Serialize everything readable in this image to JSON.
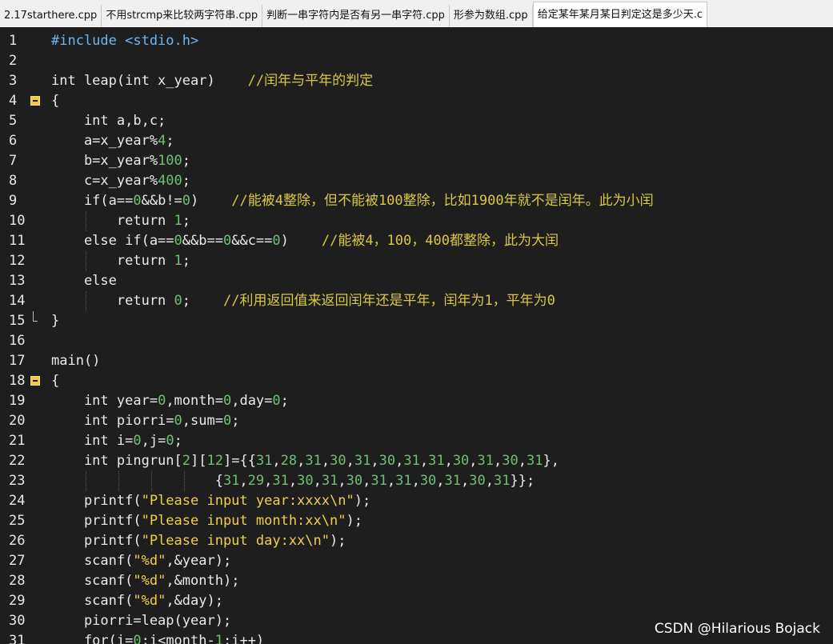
{
  "tabs": [
    {
      "label": "2.17starthere.cpp",
      "active": false
    },
    {
      "label": "不用strcmp来比较两字符串.cpp",
      "active": false
    },
    {
      "label": "判断一串字符内是否有另一串字符.cpp",
      "active": false
    },
    {
      "label": "形参为数组.cpp",
      "active": false
    },
    {
      "label": "给定某年某月某日判定这是多少天.c",
      "active": true
    }
  ],
  "lines": [
    {
      "n": "1",
      "tokens": [
        {
          "t": "#include <stdio.h>",
          "c": "inc"
        }
      ]
    },
    {
      "n": "2",
      "tokens": []
    },
    {
      "n": "3",
      "tokens": [
        {
          "t": "int leap(int x_year)    ",
          "c": "id"
        },
        {
          "t": "//闰年与平年的判定",
          "c": "cmt"
        }
      ]
    },
    {
      "n": "4",
      "fold": "open",
      "tokens": [
        {
          "t": "{",
          "c": "id"
        }
      ]
    },
    {
      "n": "5",
      "tokens": [
        {
          "t": "    int a,b,c;",
          "c": "id"
        }
      ]
    },
    {
      "n": "6",
      "tokens": [
        {
          "t": "    a=x_year%",
          "c": "id"
        },
        {
          "t": "4",
          "c": "num"
        },
        {
          "t": ";",
          "c": "id"
        }
      ]
    },
    {
      "n": "7",
      "tokens": [
        {
          "t": "    b=x_year%",
          "c": "id"
        },
        {
          "t": "100",
          "c": "num"
        },
        {
          "t": ";",
          "c": "id"
        }
      ]
    },
    {
      "n": "8",
      "tokens": [
        {
          "t": "    c=x_year%",
          "c": "id"
        },
        {
          "t": "400",
          "c": "num"
        },
        {
          "t": ";",
          "c": "id"
        }
      ]
    },
    {
      "n": "9",
      "tokens": [
        {
          "t": "    if(a==",
          "c": "id"
        },
        {
          "t": "0",
          "c": "num"
        },
        {
          "t": "&&b!=",
          "c": "id"
        },
        {
          "t": "0",
          "c": "num"
        },
        {
          "t": ")    ",
          "c": "id"
        },
        {
          "t": "//能被4整除，但不能被100整除，比如1900年就不是闰年。此为小闰",
          "c": "cmt"
        }
      ]
    },
    {
      "n": "10",
      "guides": [
        1
      ],
      "tokens": [
        {
          "t": "        return ",
          "c": "id"
        },
        {
          "t": "1",
          "c": "num"
        },
        {
          "t": ";",
          "c": "id"
        }
      ]
    },
    {
      "n": "11",
      "tokens": [
        {
          "t": "    else if(a==",
          "c": "id"
        },
        {
          "t": "0",
          "c": "num"
        },
        {
          "t": "&&b==",
          "c": "id"
        },
        {
          "t": "0",
          "c": "num"
        },
        {
          "t": "&&c==",
          "c": "id"
        },
        {
          "t": "0",
          "c": "num"
        },
        {
          "t": ")    ",
          "c": "id"
        },
        {
          "t": "//能被4，100，400都整除，此为大闰",
          "c": "cmt"
        }
      ]
    },
    {
      "n": "12",
      "guides": [
        1
      ],
      "tokens": [
        {
          "t": "        return ",
          "c": "id"
        },
        {
          "t": "1",
          "c": "num"
        },
        {
          "t": ";",
          "c": "id"
        }
      ]
    },
    {
      "n": "13",
      "tokens": [
        {
          "t": "    else",
          "c": "id"
        }
      ]
    },
    {
      "n": "14",
      "guides": [
        1
      ],
      "tokens": [
        {
          "t": "        return ",
          "c": "id"
        },
        {
          "t": "0",
          "c": "num"
        },
        {
          "t": ";    ",
          "c": "id"
        },
        {
          "t": "//利用返回值来返回闰年还是平年，闰年为1，平年为0",
          "c": "cmt"
        }
      ]
    },
    {
      "n": "15",
      "fold": "end",
      "tokens": [
        {
          "t": "}",
          "c": "id"
        }
      ]
    },
    {
      "n": "16",
      "tokens": []
    },
    {
      "n": "17",
      "tokens": [
        {
          "t": "main()",
          "c": "id"
        }
      ]
    },
    {
      "n": "18",
      "fold": "open",
      "tokens": [
        {
          "t": "{",
          "c": "id"
        }
      ]
    },
    {
      "n": "19",
      "tokens": [
        {
          "t": "    int year=",
          "c": "id"
        },
        {
          "t": "0",
          "c": "num"
        },
        {
          "t": ",month=",
          "c": "id"
        },
        {
          "t": "0",
          "c": "num"
        },
        {
          "t": ",day=",
          "c": "id"
        },
        {
          "t": "0",
          "c": "num"
        },
        {
          "t": ";",
          "c": "id"
        }
      ]
    },
    {
      "n": "20",
      "tokens": [
        {
          "t": "    int piorri=",
          "c": "id"
        },
        {
          "t": "0",
          "c": "num"
        },
        {
          "t": ",sum=",
          "c": "id"
        },
        {
          "t": "0",
          "c": "num"
        },
        {
          "t": ";",
          "c": "id"
        }
      ]
    },
    {
      "n": "21",
      "tokens": [
        {
          "t": "    int i=",
          "c": "id"
        },
        {
          "t": "0",
          "c": "num"
        },
        {
          "t": ",j=",
          "c": "id"
        },
        {
          "t": "0",
          "c": "num"
        },
        {
          "t": ";",
          "c": "id"
        }
      ]
    },
    {
      "n": "22",
      "tokens": [
        {
          "t": "    int pingrun[",
          "c": "id"
        },
        {
          "t": "2",
          "c": "num"
        },
        {
          "t": "][",
          "c": "id"
        },
        {
          "t": "12",
          "c": "num"
        },
        {
          "t": "]={{",
          "c": "id"
        },
        {
          "t": "31",
          "c": "num"
        },
        {
          "t": ",",
          "c": "id"
        },
        {
          "t": "28",
          "c": "num"
        },
        {
          "t": ",",
          "c": "id"
        },
        {
          "t": "31",
          "c": "num"
        },
        {
          "t": ",",
          "c": "id"
        },
        {
          "t": "30",
          "c": "num"
        },
        {
          "t": ",",
          "c": "id"
        },
        {
          "t": "31",
          "c": "num"
        },
        {
          "t": ",",
          "c": "id"
        },
        {
          "t": "30",
          "c": "num"
        },
        {
          "t": ",",
          "c": "id"
        },
        {
          "t": "31",
          "c": "num"
        },
        {
          "t": ",",
          "c": "id"
        },
        {
          "t": "31",
          "c": "num"
        },
        {
          "t": ",",
          "c": "id"
        },
        {
          "t": "30",
          "c": "num"
        },
        {
          "t": ",",
          "c": "id"
        },
        {
          "t": "31",
          "c": "num"
        },
        {
          "t": ",",
          "c": "id"
        },
        {
          "t": "30",
          "c": "num"
        },
        {
          "t": ",",
          "c": "id"
        },
        {
          "t": "31",
          "c": "num"
        },
        {
          "t": "},",
          "c": "id"
        }
      ]
    },
    {
      "n": "23",
      "guides": [
        1,
        2,
        3,
        4
      ],
      "tokens": [
        {
          "t": "                    {",
          "c": "id"
        },
        {
          "t": "31",
          "c": "num"
        },
        {
          "t": ",",
          "c": "id"
        },
        {
          "t": "29",
          "c": "num"
        },
        {
          "t": ",",
          "c": "id"
        },
        {
          "t": "31",
          "c": "num"
        },
        {
          "t": ",",
          "c": "id"
        },
        {
          "t": "30",
          "c": "num"
        },
        {
          "t": ",",
          "c": "id"
        },
        {
          "t": "31",
          "c": "num"
        },
        {
          "t": ",",
          "c": "id"
        },
        {
          "t": "30",
          "c": "num"
        },
        {
          "t": ",",
          "c": "id"
        },
        {
          "t": "31",
          "c": "num"
        },
        {
          "t": ",",
          "c": "id"
        },
        {
          "t": "31",
          "c": "num"
        },
        {
          "t": ",",
          "c": "id"
        },
        {
          "t": "30",
          "c": "num"
        },
        {
          "t": ",",
          "c": "id"
        },
        {
          "t": "31",
          "c": "num"
        },
        {
          "t": ",",
          "c": "id"
        },
        {
          "t": "30",
          "c": "num"
        },
        {
          "t": ",",
          "c": "id"
        },
        {
          "t": "31",
          "c": "num"
        },
        {
          "t": "}};",
          "c": "id"
        }
      ]
    },
    {
      "n": "24",
      "tokens": [
        {
          "t": "    printf(",
          "c": "id"
        },
        {
          "t": "\"Please input year:xxxx\\n\"",
          "c": "str"
        },
        {
          "t": ");",
          "c": "id"
        }
      ]
    },
    {
      "n": "25",
      "tokens": [
        {
          "t": "    printf(",
          "c": "id"
        },
        {
          "t": "\"Please input month:xx\\n\"",
          "c": "str"
        },
        {
          "t": ");",
          "c": "id"
        }
      ]
    },
    {
      "n": "26",
      "tokens": [
        {
          "t": "    printf(",
          "c": "id"
        },
        {
          "t": "\"Please input day:xx\\n\"",
          "c": "str"
        },
        {
          "t": ");",
          "c": "id"
        }
      ]
    },
    {
      "n": "27",
      "tokens": [
        {
          "t": "    scanf(",
          "c": "id"
        },
        {
          "t": "\"%d\"",
          "c": "str"
        },
        {
          "t": ",&year);",
          "c": "id"
        }
      ]
    },
    {
      "n": "28",
      "tokens": [
        {
          "t": "    scanf(",
          "c": "id"
        },
        {
          "t": "\"%d\"",
          "c": "str"
        },
        {
          "t": ",&month);",
          "c": "id"
        }
      ]
    },
    {
      "n": "29",
      "tokens": [
        {
          "t": "    scanf(",
          "c": "id"
        },
        {
          "t": "\"%d\"",
          "c": "str"
        },
        {
          "t": ",&day);",
          "c": "id"
        }
      ]
    },
    {
      "n": "30",
      "tokens": [
        {
          "t": "    piorri=leap(year);",
          "c": "id"
        }
      ]
    },
    {
      "n": "31",
      "tokens": [
        {
          "t": "    for(i=",
          "c": "id"
        },
        {
          "t": "0",
          "c": "num"
        },
        {
          "t": ";i<month-",
          "c": "id"
        },
        {
          "t": "1",
          "c": "num"
        },
        {
          "t": ";i++)",
          "c": "id"
        }
      ]
    }
  ],
  "watermark": "CSDN @Hilarious Bojack",
  "colors": {
    "editor_bg": "#1e1e1e",
    "include": "#73b5f0",
    "number": "#6fbf73",
    "string": "#f0d04a",
    "comment": "#d8c843",
    "fold_marker": "#f2c744"
  }
}
